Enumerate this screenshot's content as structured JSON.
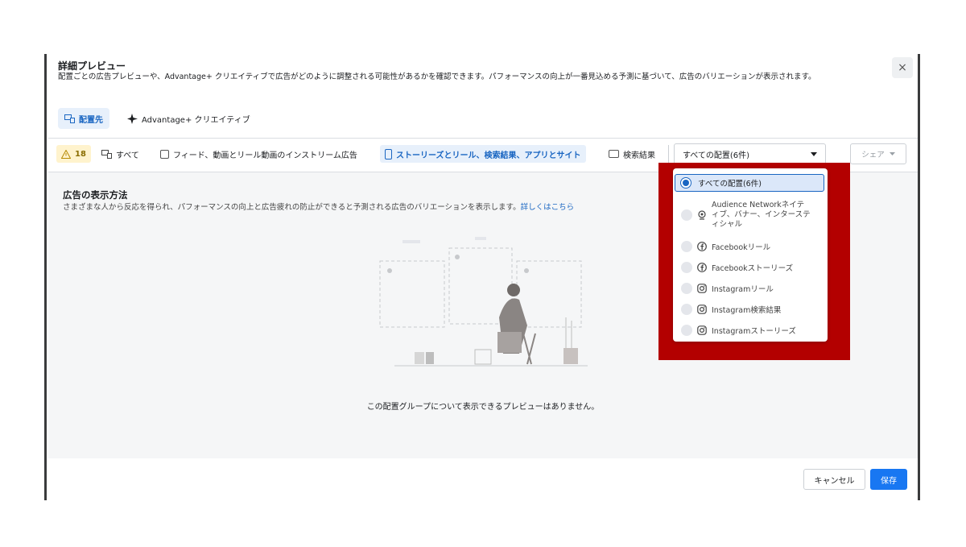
{
  "dialog": {
    "title": "詳細プレビュー",
    "description": "配置ごとの広告プレビューや、Advantage+ クリエイティブで広告がどのように調整される可能性があるかを確認できます。パフォーマンスの向上が一番見込める予測に基づいて、広告のバリエーションが表示されます。",
    "close_icon": "×"
  },
  "tabs": [
    {
      "label": "配置先",
      "icon": "placement-icon"
    },
    {
      "label": "Advantage+ クリエイティブ",
      "icon": "sparkle-icon"
    }
  ],
  "toolbar": {
    "warning_count": "18",
    "all_label": "すべて",
    "feed_label": "フィード、動画とリール動画のインストリーム広告",
    "stories_label": "ストーリーズとリール、検索結果、アプリとサイト",
    "search_label": "検索結果",
    "select_value": "すべての配置(6件)",
    "share_label": "シェア"
  },
  "content": {
    "heading": "広告の表示方法",
    "subtext": "さまざまな人から反応を得られ、パフォーマンスの向上と広告疲れの防止ができると予測される広告のバリエーションを表示します。",
    "learn_more": "詳しくはこちら",
    "empty_message": "この配置グループについて表示できるプレビューはありません。"
  },
  "dropdown": {
    "options": [
      {
        "label": "すべての配置(6件)",
        "selected": true,
        "icon": ""
      },
      {
        "label": "Audience Networkネイティブ、バナー、インタースティシャル",
        "selected": false,
        "icon": "audience-network-icon"
      },
      {
        "label": "Facebookリール",
        "selected": false,
        "icon": "facebook-icon"
      },
      {
        "label": "Facebookストーリーズ",
        "selected": false,
        "icon": "facebook-icon"
      },
      {
        "label": "Instagramリール",
        "selected": false,
        "icon": "instagram-icon"
      },
      {
        "label": "Instagram検索結果",
        "selected": false,
        "icon": "instagram-icon"
      },
      {
        "label": "Instagramストーリーズ",
        "selected": false,
        "icon": "instagram-icon"
      }
    ]
  },
  "footer": {
    "cancel_label": "キャンセル",
    "save_label": "保存"
  },
  "colors": {
    "accent": "#1a66c2",
    "primary_button": "#1877f2",
    "highlight_box": "#b30000",
    "warning_bg": "#fff3cd"
  }
}
